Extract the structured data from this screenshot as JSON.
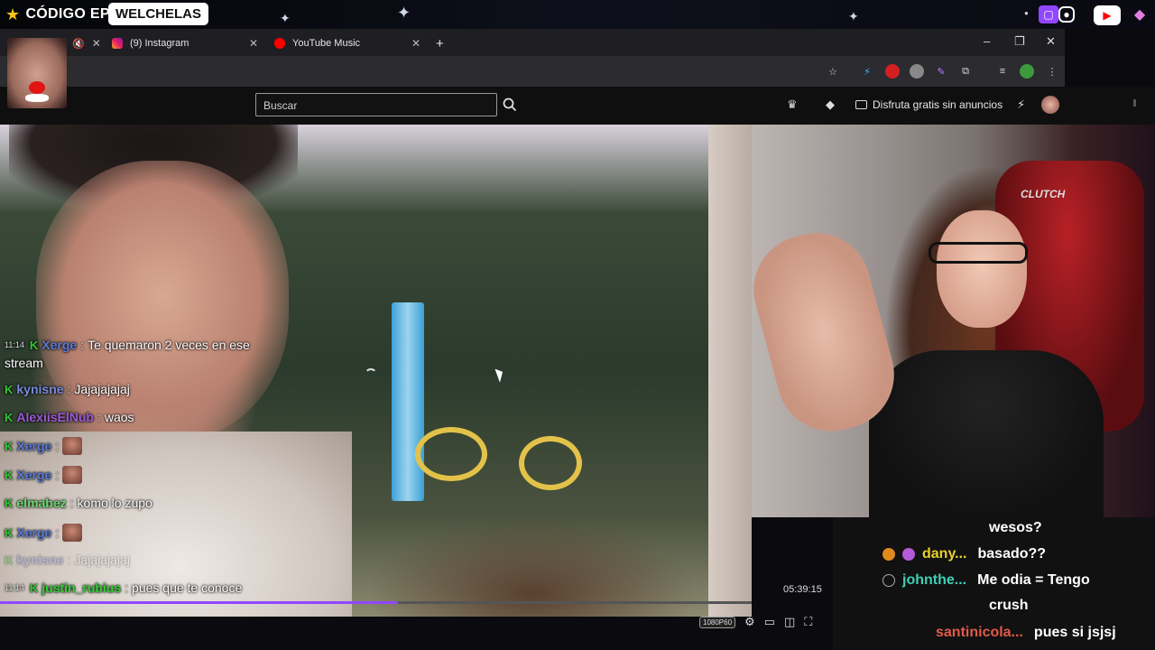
{
  "overlay": {
    "brand_label": "CÓDIGO EPIC",
    "badge_label": "WELCHELAS",
    "social_icons": [
      "twitch-icon",
      "instagram-icon",
      "youtube-icon",
      "gem-icon"
    ]
  },
  "browser": {
    "tabs": [
      {
        "label": "",
        "icon": "muted-audio-icon"
      },
      {
        "label": "(9) Instagram",
        "icon": "instagram-icon"
      },
      {
        "label": "YouTube Music",
        "icon": "youtube-music-icon"
      }
    ],
    "new_tab": "+",
    "window_controls": [
      "minimize",
      "restore",
      "close"
    ]
  },
  "youtube": {
    "search_placeholder": "Buscar",
    "ad_free_label": "Disfruta gratis sin anuncios"
  },
  "player": {
    "progress": 0.53,
    "time_remaining": "05:39:15",
    "quality": "1080P60"
  },
  "chat_overlay": [
    {
      "ts": "11:14",
      "user": "Xerge",
      "color": "#5a7ad8",
      "msg": "Te quemaron 2 veces en ese"
    },
    {
      "ts": "",
      "user": "",
      "color": "",
      "msg": "stream"
    },
    {
      "ts": "",
      "user": "kynisne",
      "color": "#7a8ae0",
      "msg": "Jajajajajaj"
    },
    {
      "ts": "",
      "user": "AlexiisElNub",
      "color": "#9b5ad8",
      "msg": "waos"
    },
    {
      "ts": "",
      "user": "Xerge",
      "color": "#5a7ad8",
      "msg": ""
    },
    {
      "ts": "",
      "user": "Xerge",
      "color": "#5a7ad8",
      "msg": ""
    },
    {
      "ts": "",
      "user": "elmabez",
      "color": "#6fd96f",
      "msg": "komo lo zupo"
    },
    {
      "ts": "",
      "user": "Xerge",
      "color": "#5a7ad8",
      "msg": ""
    },
    {
      "ts": "",
      "user": "kynisne",
      "color": "#7a8ae0",
      "msg": "Jajajajajaj"
    },
    {
      "ts": "11:14",
      "user": "justin_rubius",
      "color": "#32d032",
      "msg": "pues que te conoce"
    }
  ],
  "chat_right": [
    {
      "user": "",
      "color": "",
      "msg": "wesos?"
    },
    {
      "user": "dany...",
      "color": "#e6d12a",
      "msg": "basado??"
    },
    {
      "user": "johnthe...",
      "color": "#3fd0b5",
      "msg": "Me odia = Tengo"
    },
    {
      "user": "",
      "color": "",
      "msg": "crush"
    },
    {
      "user": "santinicola...",
      "color": "#e25a4a",
      "msg": "pues si jsjsj"
    }
  ],
  "colors": {
    "accent": "#9146ff",
    "twitch": "#9146ff",
    "youtube_red": "#ff0000"
  }
}
